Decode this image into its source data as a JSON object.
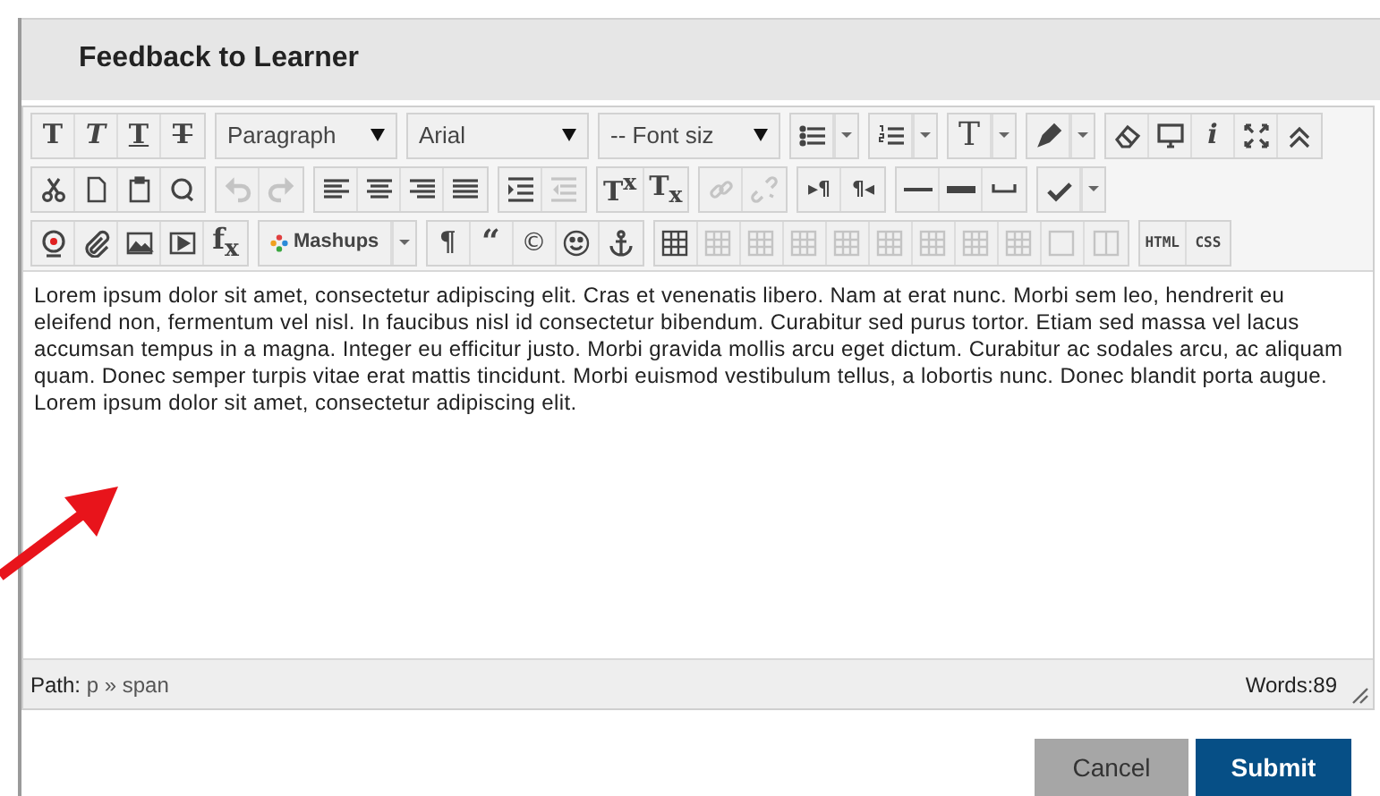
{
  "window": {
    "title": "Feedback to Learner"
  },
  "toolbar": {
    "lines": [
      {
        "groups": [
          {
            "items": [
              {
                "kind": "bold",
                "label": "T"
              },
              {
                "kind": "italic",
                "label": "T"
              },
              {
                "kind": "underline",
                "label": "T"
              },
              {
                "kind": "strike",
                "label": "T"
              }
            ]
          },
          {
            "items": [
              {
                "kind": "select",
                "value": "Paragraph"
              }
            ]
          },
          {
            "items": [
              {
                "kind": "select",
                "value": "Arial"
              }
            ]
          },
          {
            "items": [
              {
                "kind": "select",
                "value": "-- Font siz"
              }
            ]
          },
          {
            "items": [
              {
                "kind": "bullets",
                "split": true
              }
            ]
          },
          {
            "items": [
              {
                "kind": "numbered",
                "split": true
              }
            ]
          },
          {
            "items": [
              {
                "kind": "textcolor",
                "label": "T",
                "split": true
              }
            ]
          },
          {
            "items": [
              {
                "kind": "highlighter",
                "split": true
              }
            ]
          },
          {
            "items": [
              {
                "kind": "eraser"
              },
              {
                "kind": "monitor"
              },
              {
                "kind": "info",
                "label": "i"
              },
              {
                "kind": "fullscreen"
              },
              {
                "kind": "collapse"
              }
            ]
          }
        ]
      },
      {
        "groups": [
          {
            "items": [
              {
                "kind": "cut"
              },
              {
                "kind": "copy"
              },
              {
                "kind": "paste"
              },
              {
                "kind": "find"
              }
            ]
          },
          {
            "items": [
              {
                "kind": "undo",
                "disabled": true
              },
              {
                "kind": "redo",
                "disabled": true
              }
            ]
          },
          {
            "items": [
              {
                "kind": "alignleft"
              },
              {
                "kind": "aligncenter"
              },
              {
                "kind": "alignright"
              },
              {
                "kind": "justify"
              }
            ]
          },
          {
            "items": [
              {
                "kind": "indent"
              },
              {
                "kind": "outdent",
                "disabled": true
              }
            ]
          },
          {
            "items": [
              {
                "kind": "sup",
                "label": "T$^{x}$"
              },
              {
                "kind": "sub",
                "label": "T$_{x}$"
              }
            ]
          },
          {
            "items": [
              {
                "kind": "link",
                "disabled": true
              },
              {
                "kind": "unlink",
                "disabled": true
              }
            ]
          },
          {
            "items": [
              {
                "kind": "ltr",
                "label": "▸¶"
              },
              {
                "kind": "rtl",
                "label": "¶◂"
              }
            ]
          },
          {
            "items": [
              {
                "kind": "hr"
              },
              {
                "kind": "thickhr"
              },
              {
                "kind": "nbsp"
              }
            ]
          },
          {
            "items": [
              {
                "kind": "spellcheck",
                "split": true
              }
            ]
          }
        ]
      },
      {
        "groups": [
          {
            "items": [
              {
                "kind": "record"
              },
              {
                "kind": "attach"
              },
              {
                "kind": "image"
              },
              {
                "kind": "media"
              },
              {
                "kind": "fx",
                "label": "f$_{x}$"
              }
            ]
          },
          {
            "items": [
              {
                "kind": "mashups",
                "label": "Mashups",
                "split": true
              }
            ]
          },
          {
            "items": [
              {
                "kind": "pilcrow",
                "label": "¶"
              },
              {
                "kind": "quote",
                "label": "“"
              },
              {
                "kind": "copyright",
                "label": "©"
              },
              {
                "kind": "smiley"
              },
              {
                "kind": "anchor"
              }
            ]
          },
          {
            "items": [
              {
                "kind": "table"
              },
              {
                "kind": "tableop",
                "disabled": true
              },
              {
                "kind": "tableop",
                "disabled": true
              },
              {
                "kind": "tableop",
                "disabled": true
              },
              {
                "kind": "tableop",
                "disabled": true
              },
              {
                "kind": "tableop",
                "disabled": true
              },
              {
                "kind": "tableop",
                "disabled": true
              },
              {
                "kind": "tableop",
                "disabled": true
              },
              {
                "kind": "tableop",
                "disabled": true
              },
              {
                "kind": "cellbox",
                "disabled": true
              },
              {
                "kind": "splitbox",
                "disabled": true
              }
            ]
          },
          {
            "items": [
              {
                "kind": "html",
                "label": "HTML"
              },
              {
                "kind": "css",
                "label": "CSS"
              }
            ]
          }
        ]
      }
    ]
  },
  "content": "Lorem ipsum dolor sit amet, consectetur adipiscing elit. Cras et venenatis libero. Nam at erat nunc. Morbi sem leo, hendrerit eu eleifend non, fermentum vel nisl. In faucibus nisl id consectetur bibendum. Curabitur sed purus tortor. Etiam sed massa vel lacus accumsan tempus in a magna. Integer eu efficitur justo. Morbi gravida mollis arcu eget dictum. Curabitur ac sodales arcu, ac aliquam quam. Donec semper turpis vitae erat mattis tincidunt. Morbi euismod vestibulum tellus, a lobortis nunc. Donec blandit porta augue. Lorem ipsum dolor sit amet, consectetur adipiscing elit.",
  "status_bar": {
    "path_label": "Path:",
    "path": "p » span",
    "words": "Words:89"
  },
  "buttons": [
    {
      "kind": "cancel",
      "label": "Cancel"
    },
    {
      "kind": "submit",
      "label": "Submit"
    }
  ]
}
